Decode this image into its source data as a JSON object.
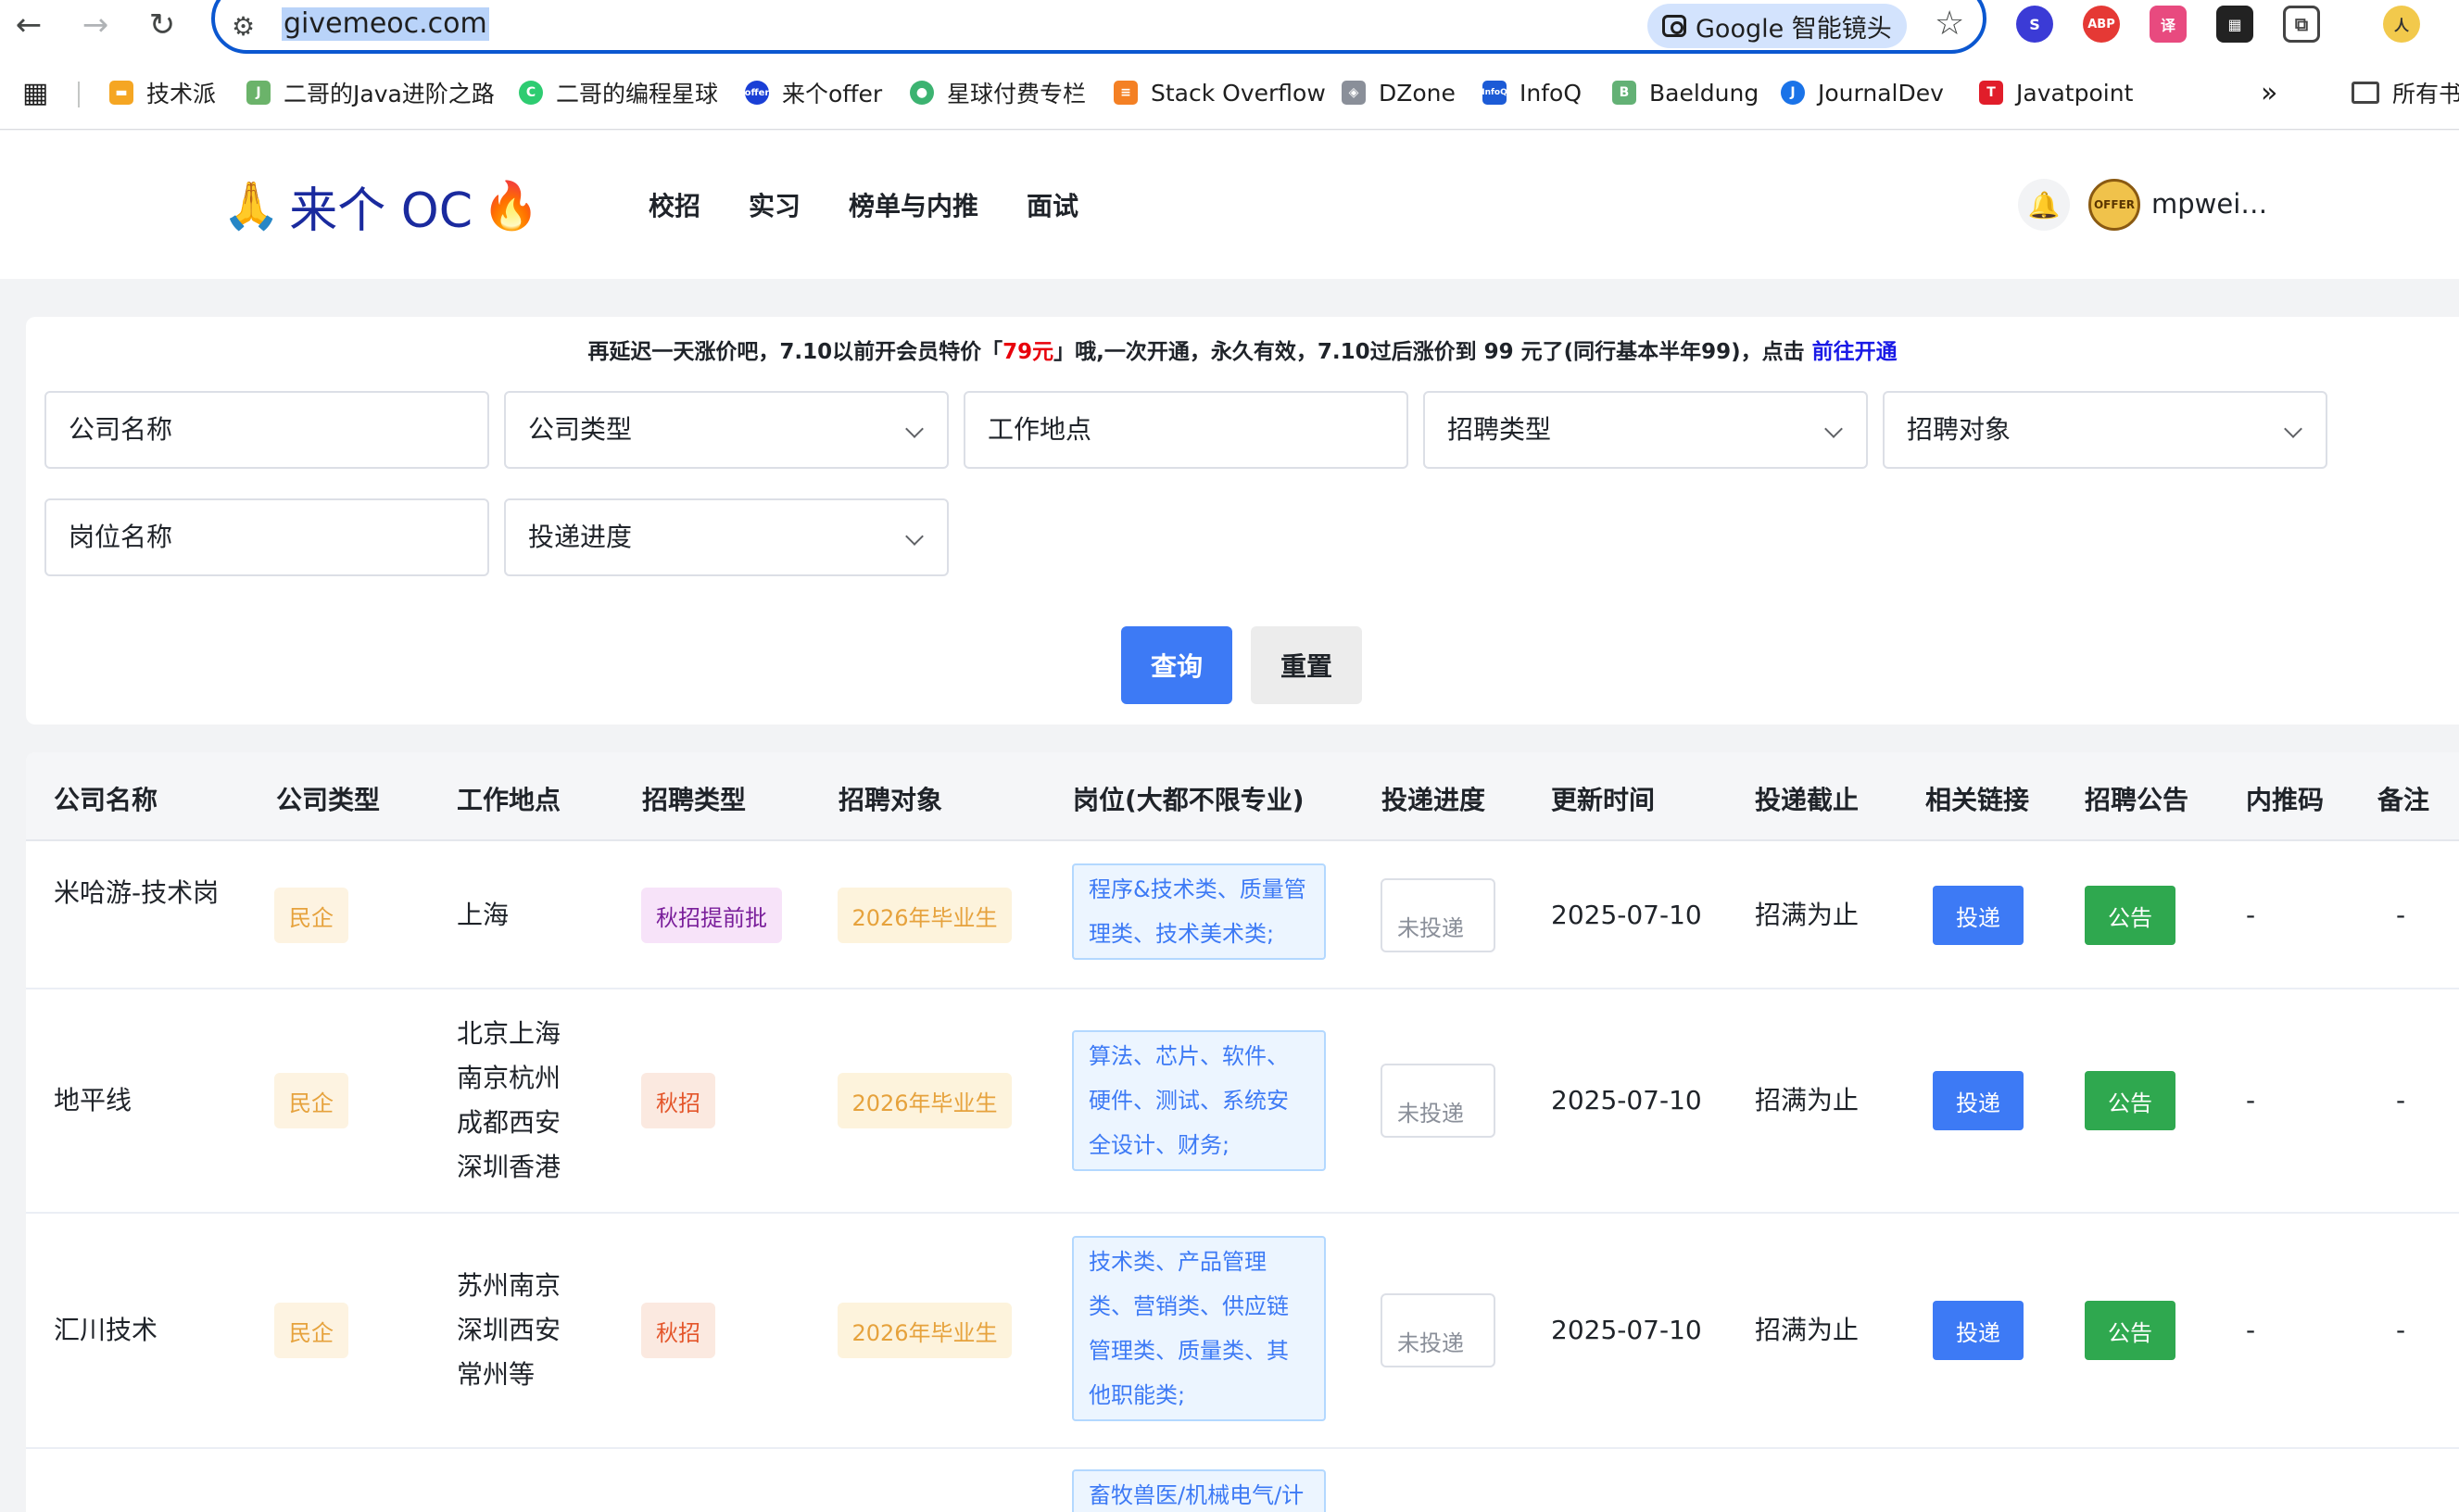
{
  "browser": {
    "url": "givemeoc.com",
    "lens_label": "Google 智能镜头",
    "bookmarks": [
      {
        "label": "技术派",
        "color": "#f5a623"
      },
      {
        "label": "二哥的Java进阶之路",
        "color": "#6bb36a"
      },
      {
        "label": "二哥的编程星球",
        "color": "#2ecc71"
      },
      {
        "label": "来个offer",
        "color": "#1a3fd6"
      },
      {
        "label": "星球付费专栏",
        "color": "#3cb371"
      },
      {
        "label": "Stack Overflow",
        "color": "#f48024"
      },
      {
        "label": "DZone",
        "color": "#8a8f99"
      },
      {
        "label": "InfoQ",
        "color": "#1c5bd6"
      },
      {
        "label": "Baeldung",
        "color": "#63b175"
      },
      {
        "label": "JournalDev",
        "color": "#1a73e8"
      },
      {
        "label": "Javatpoint",
        "color": "#e11d2a"
      }
    ],
    "more_label": "»",
    "all_bookmarks_label": "所有书"
  },
  "header": {
    "logo_text": "来个 OC",
    "logo_emoji_left": "🙏",
    "logo_emoji_right": "🔥",
    "nav": [
      "校招",
      "实习",
      "榜单与内推",
      "面试"
    ],
    "username": "mpwei…"
  },
  "filters": {
    "promo_prefix": "再延迟一天涨价吧，7.10以前开会员特价「",
    "promo_price": "79元",
    "promo_suffix": "」哦,一次开通，永久有效，7.10过后涨价到 99 元了(同行基本半年99)，点击 ",
    "promo_link": "前往开通",
    "company_name": "公司名称",
    "company_type": "公司类型",
    "work_location": "工作地点",
    "recruit_type": "招聘类型",
    "recruit_target": "招聘对象",
    "position_name": "岗位名称",
    "apply_progress": "投递进度",
    "query_button": "查询",
    "reset_button": "重置"
  },
  "table": {
    "columns": [
      "公司名称",
      "公司类型",
      "工作地点",
      "招聘类型",
      "招聘对象",
      "岗位(大都不限专业)",
      "投递进度",
      "更新时间",
      "投递截止",
      "相关链接",
      "招聘公告",
      "内推码",
      "备注"
    ],
    "apply_button": "投递",
    "notice_button": "公告",
    "progress_placeholder": "未投递",
    "rows": [
      {
        "company": "米哈游-技术岗",
        "type": "民企",
        "location": "上海",
        "recruit_type": "秋招提前批",
        "target": "2026年毕业生",
        "positions": "程序&技术类、质量管理类、技术美术类;",
        "updated": "2025-07-10",
        "deadline": "招满为止",
        "referral": "-",
        "remark": "-"
      },
      {
        "company": "地平线",
        "type": "民企",
        "location": "北京上海南京杭州成都西安深圳香港",
        "recruit_type": "秋招",
        "target": "2026年毕业生",
        "positions": "算法、芯片、软件、硬件、测试、系统安全设计、财务;",
        "updated": "2025-07-10",
        "deadline": "招满为止",
        "referral": "-",
        "remark": "-"
      },
      {
        "company": "汇川技术",
        "type": "民企",
        "location": "苏州南京深圳西安常州等",
        "recruit_type": "秋招",
        "target": "2026年毕业生",
        "positions": "技术类、产品管理类、营销类、供应链管理类、质量类、其他职能类;",
        "updated": "2025-07-10",
        "deadline": "招满为止",
        "referral": "-",
        "remark": "-"
      },
      {
        "positions": "畜牧兽医/机械电气/计"
      }
    ]
  }
}
